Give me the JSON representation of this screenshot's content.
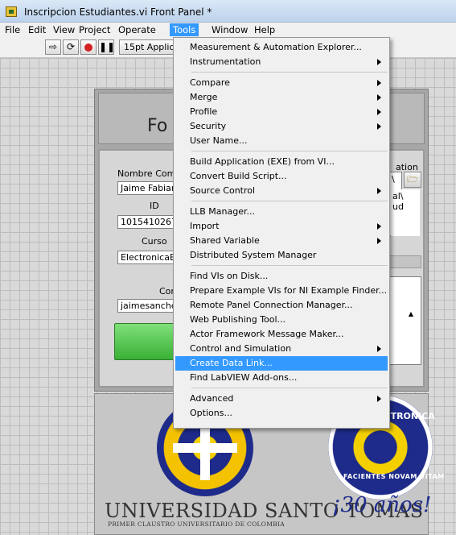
{
  "window": {
    "title": "Inscripcion Estudiantes.vi Front Panel *"
  },
  "menubar": [
    {
      "label": "File"
    },
    {
      "label": "Edit"
    },
    {
      "label": "View"
    },
    {
      "label": "Project"
    },
    {
      "label": "Operate"
    },
    {
      "label": "Tools",
      "active": true
    },
    {
      "label": "Window"
    },
    {
      "label": "Help"
    }
  ],
  "toolbar": {
    "font_label": "15pt Applic"
  },
  "panel": {
    "header_text": "Fo",
    "labels": {
      "nombre": "Nombre Comp",
      "id": "ID",
      "curso": "Curso",
      "correo": "Cor",
      "ubicacion": "ation"
    },
    "fields": {
      "nombre": "Jaime Fabian",
      "id": "1015410267",
      "curso": "ElectronicaBa",
      "correo": "jaimesanchez"
    },
    "path_box": [
      "\\",
      "al\\",
      "ud"
    ]
  },
  "logos": {
    "ust_name": "UNIVERSIDAD SANTO TOMAS",
    "ust_sub": "PRIMER CLAUSTRO UNIVERSITARIO DE COLOMBIA",
    "elec_top": "ECTRONICA",
    "elec_motto": "FACIENTES NOVAM VITAM",
    "anos": "¡30 años!"
  },
  "tools_menu": [
    {
      "label": "Measurement & Automation Explorer..."
    },
    {
      "label": "Instrumentation",
      "submenu": true
    },
    {
      "sep": true
    },
    {
      "label": "Compare",
      "submenu": true
    },
    {
      "label": "Merge",
      "submenu": true
    },
    {
      "label": "Profile",
      "submenu": true
    },
    {
      "label": "Security",
      "submenu": true
    },
    {
      "label": "User Name..."
    },
    {
      "sep": true
    },
    {
      "label": "Build Application (EXE) from VI..."
    },
    {
      "label": "Convert Build Script..."
    },
    {
      "label": "Source Control",
      "submenu": true
    },
    {
      "sep": true
    },
    {
      "label": "LLB Manager..."
    },
    {
      "label": "Import",
      "submenu": true
    },
    {
      "label": "Shared Variable",
      "submenu": true
    },
    {
      "label": "Distributed System Manager"
    },
    {
      "sep": true
    },
    {
      "label": "Find VIs on Disk..."
    },
    {
      "label": "Prepare Example VIs for NI Example Finder..."
    },
    {
      "label": "Remote Panel Connection Manager..."
    },
    {
      "label": "Web Publishing Tool..."
    },
    {
      "label": "Actor Framework Message Maker..."
    },
    {
      "label": "Control and Simulation",
      "submenu": true
    },
    {
      "label": "Create Data Link...",
      "highlighted": true
    },
    {
      "label": "Find LabVIEW Add-ons..."
    },
    {
      "sep": true
    },
    {
      "label": "Advanced",
      "submenu": true
    },
    {
      "label": "Options..."
    }
  ]
}
